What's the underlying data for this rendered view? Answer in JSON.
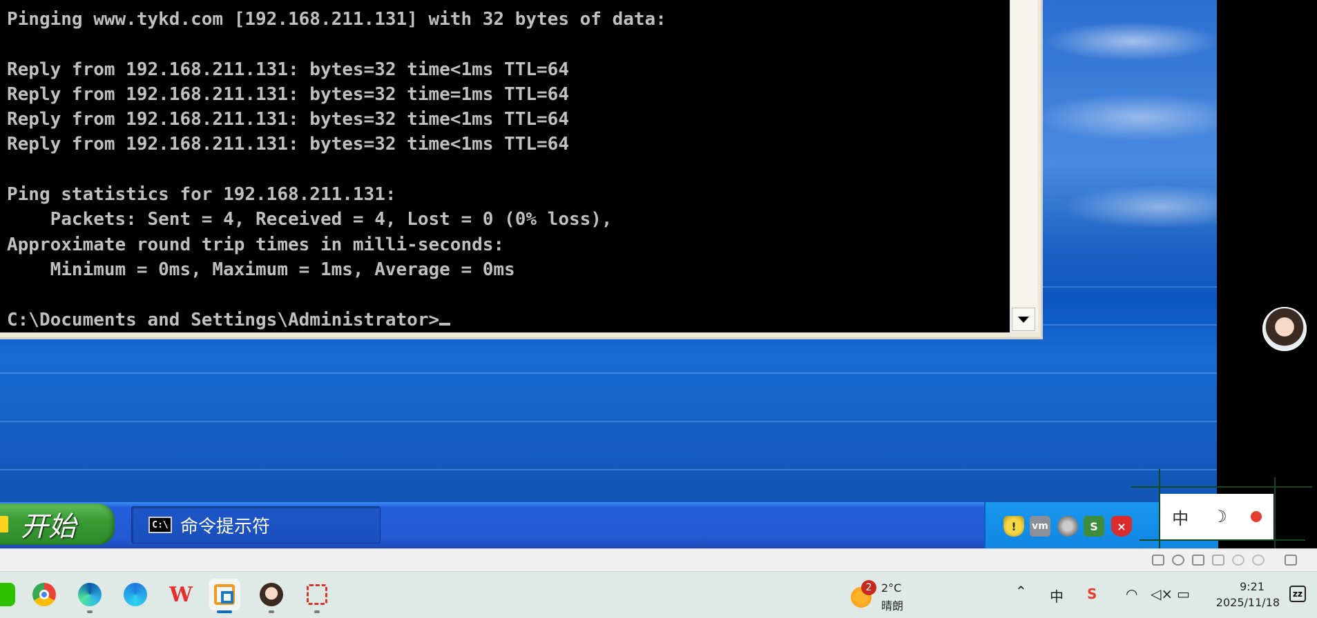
{
  "console": {
    "lines": [
      "Pinging www.tykd.com [192.168.211.131] with 32 bytes of data:",
      "",
      "Reply from 192.168.211.131: bytes=32 time<1ms TTL=64",
      "Reply from 192.168.211.131: bytes=32 time=1ms TTL=64",
      "Reply from 192.168.211.131: bytes=32 time<1ms TTL=64",
      "Reply from 192.168.211.131: bytes=32 time<1ms TTL=64",
      "",
      "Ping statistics for 192.168.211.131:",
      "    Packets: Sent = 4, Received = 4, Lost = 0 (0% loss),",
      "Approximate round trip times in milli-seconds:",
      "    Minimum = 0ms, Maximum = 1ms, Average = 0ms",
      ""
    ],
    "prompt": "C:\\Documents and Settings\\Administrator>"
  },
  "xp_taskbar": {
    "start_label": "开始",
    "task_label": "命令提示符",
    "cmd_icon_text": "C:\\",
    "tray_icons": [
      "shield-icon",
      "vm-icon",
      "speaker-icon",
      "network-icon",
      "alert-icon"
    ]
  },
  "ime": {
    "mode": "中",
    "moon": "☽"
  },
  "win_taskbar": {
    "apps": [
      "wechat-icon",
      "chrome-icon",
      "edge-icon",
      "edge-ai-icon",
      "wps-icon",
      "vmware-icon",
      "avatar-app-icon",
      "snipping-tool-icon"
    ],
    "weather": {
      "badge": "2",
      "temp": "2°C",
      "condition": "晴朗"
    },
    "ime_indicator": "中",
    "clock": {
      "time": "9:21",
      "date": "2025/11/18"
    }
  },
  "colors": {
    "console_bg": "#000000",
    "console_fg": "#c0c0c0",
    "xp_taskbar": "#245edb",
    "start_green": "#3a9b35",
    "win_taskbar": "#dfe9e6"
  }
}
